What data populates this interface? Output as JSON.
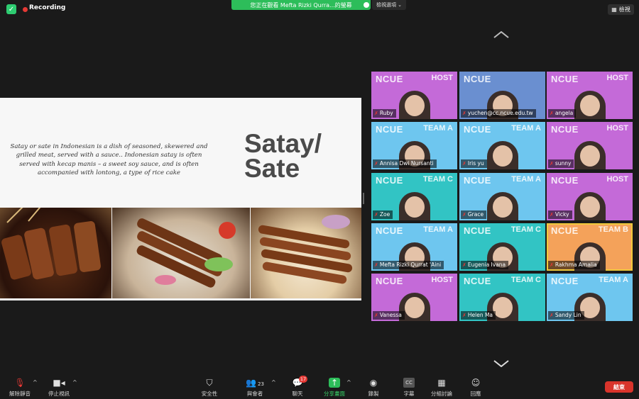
{
  "topbar": {
    "recording": "Recording",
    "share_banner": "您正在觀看 Mefta Rizki Qurra...的螢幕",
    "view_options": "檢視選項 ⌄",
    "view_button": "檢視"
  },
  "slide": {
    "title_line1": "Satay/",
    "title_line2": "Sate",
    "body": "Satay or sate in Indonesian is a dish of seasoned, skewered and grilled meat, served with a sauce.. Indonesian satay is often served with kecap manis – a sweet soy sauce, and is often accompanied with lontong, a type of rice cake"
  },
  "participants": [
    {
      "name": "Ruby",
      "brand": "NCUE",
      "role": "HOST",
      "bg": "#c46ad8"
    },
    {
      "name": "yuchen@cc.ncue.edu.tw",
      "brand": "NCUE",
      "role": "",
      "bg": "#6a8fd0"
    },
    {
      "name": "angela",
      "brand": "NCUE",
      "role": "HOST",
      "bg": "#c46ad8"
    },
    {
      "name": "Annisa Dwi Nursanti",
      "brand": "NCUE",
      "role": "TEAM A",
      "bg": "#6ec6ef"
    },
    {
      "name": "Iris yu",
      "brand": "NCUE",
      "role": "TEAM A",
      "bg": "#6ec6ef"
    },
    {
      "name": "sunny",
      "brand": "NCUE",
      "role": "HOST",
      "bg": "#c46ad8"
    },
    {
      "name": "Zoe",
      "brand": "NCUE",
      "role": "TEAM C",
      "bg": "#32c4c4"
    },
    {
      "name": "Grace",
      "brand": "NCUE",
      "role": "TEAM A",
      "bg": "#6ec6ef"
    },
    {
      "name": "Vicky",
      "brand": "NCUE",
      "role": "HOST",
      "bg": "#c46ad8"
    },
    {
      "name": "Mefta Rizki Qurrat 'Aini",
      "brand": "NCUE",
      "role": "TEAM A",
      "bg": "#6ec6ef"
    },
    {
      "name": "Eugenia Ivana",
      "brand": "NCUE",
      "role": "TEAM C",
      "bg": "#32c4c4"
    },
    {
      "name": "Rakhma Amalia",
      "brand": "NCUE",
      "role": "TEAM B",
      "bg": "#f4a25a"
    },
    {
      "name": "Vanessa",
      "brand": "NCUE",
      "role": "HOST",
      "bg": "#c46ad8"
    },
    {
      "name": "Helen Ma",
      "brand": "NCUE",
      "role": "TEAM C",
      "bg": "#32c4c4"
    },
    {
      "name": "Sandy Lin",
      "brand": "NCUE",
      "role": "TEAM A",
      "bg": "#6ec6ef"
    }
  ],
  "toolbar": {
    "unmute": "解除靜音",
    "stop_video": "停止視訊",
    "security": "安全性",
    "participants": "與會者",
    "participants_count": "23",
    "chat": "聊天",
    "chat_badge": "17",
    "share_screen": "分享畫面",
    "record": "錄製",
    "captions": "字幕",
    "breakout": "分組討論",
    "reactions": "回應",
    "end": "結束",
    "captions_icon_text": "CC"
  },
  "colors": {
    "accent_green": "#2dbd5a",
    "end_red": "#d9342b",
    "recording_red": "#e53935",
    "highlight": "#f0c93b"
  }
}
